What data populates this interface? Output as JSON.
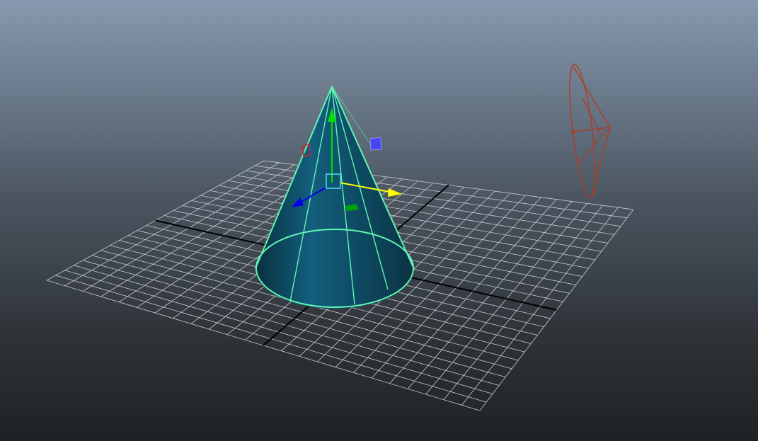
{
  "viewport": {
    "background_top": "#8799ae",
    "background_bottom": "#1f2225"
  },
  "scene": {
    "grid": {
      "divisions": 24,
      "line_color": "#c9ccd0",
      "axis_color": "#000000"
    },
    "cone": {
      "state": "selected",
      "surface_color": "#0f4d67",
      "wireframe_color": "#62f5b3"
    },
    "manipulator": {
      "tool": "move",
      "x_axis_color": "#ffff00",
      "y_axis_color": "#00e000",
      "z_axis_color": "#0000ee",
      "center_color": "#5fd7ff",
      "plane_handles": {
        "xz": "#00aa00",
        "xy": "#4444ff",
        "yz": "#cc2222"
      }
    },
    "light": {
      "type": "spot",
      "color": "#b33a1c"
    }
  }
}
